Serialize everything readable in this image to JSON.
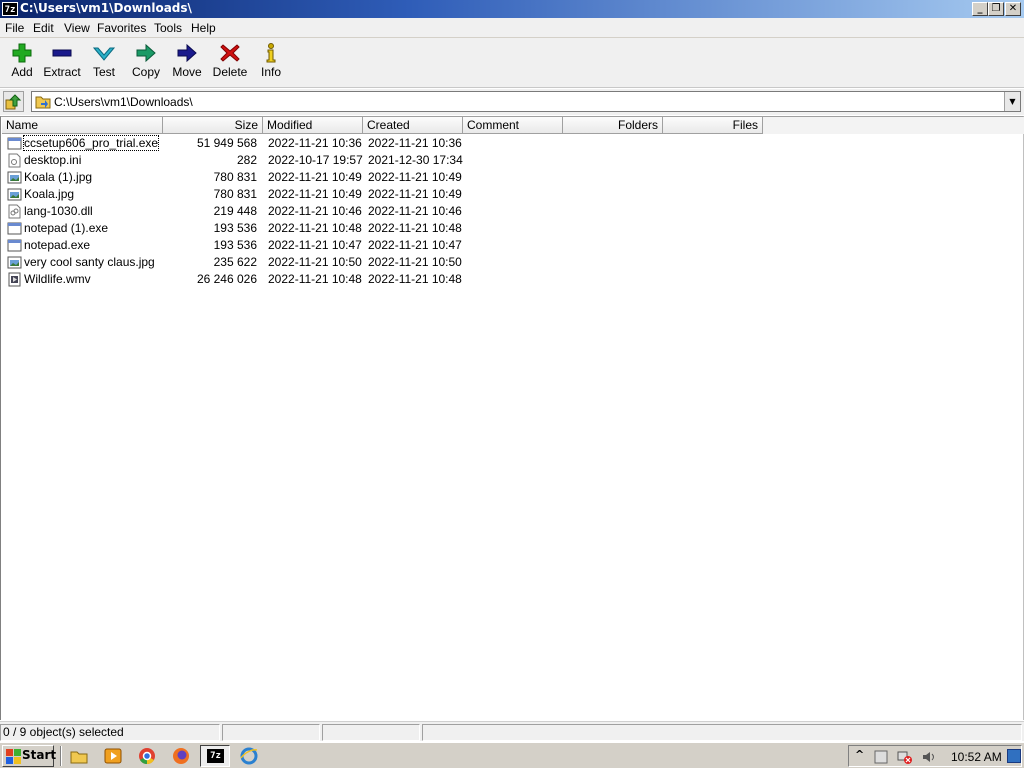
{
  "window": {
    "title": "C:\\Users\\vm1\\Downloads\\",
    "app_icon_text": "7z",
    "controls": {
      "minimize": "_",
      "maximize": "❐",
      "close": "✕"
    }
  },
  "menu": [
    "File",
    "Edit",
    "View",
    "Favorites",
    "Tools",
    "Help"
  ],
  "toolbar": [
    {
      "label": "Add",
      "icon": "add-icon",
      "color": "#22aa22"
    },
    {
      "label": "Extract",
      "icon": "extract-icon",
      "color": "#1a1a8c"
    },
    {
      "label": "Test",
      "icon": "test-icon",
      "color": "#2ab0c8"
    },
    {
      "label": "Copy",
      "icon": "copy-icon",
      "color": "#1a9a66"
    },
    {
      "label": "Move",
      "icon": "move-icon",
      "color": "#1a1a8c"
    },
    {
      "label": "Delete",
      "icon": "delete-icon",
      "color": "#d01010"
    },
    {
      "label": "Info",
      "icon": "info-icon",
      "color": "#c8a800"
    }
  ],
  "address": {
    "path": "C:\\Users\\vm1\\Downloads\\"
  },
  "columns": [
    "Name",
    "Size",
    "Modified",
    "Created",
    "Comment",
    "Folders",
    "Files"
  ],
  "files": [
    {
      "name": "ccsetup606_pro_trial.exe",
      "size": "51 949 568",
      "modified": "2022-11-21 10:36",
      "created": "2022-11-21 10:36",
      "icon": "exe-icon"
    },
    {
      "name": "desktop.ini",
      "size": "282",
      "modified": "2022-10-17 19:57",
      "created": "2021-12-30 17:34",
      "icon": "settings-file-icon"
    },
    {
      "name": "Koala (1).jpg",
      "size": "780 831",
      "modified": "2022-11-21 10:49",
      "created": "2022-11-21 10:49",
      "icon": "image-icon"
    },
    {
      "name": "Koala.jpg",
      "size": "780 831",
      "modified": "2022-11-21 10:49",
      "created": "2022-11-21 10:49",
      "icon": "image-icon"
    },
    {
      "name": "lang-1030.dll",
      "size": "219 448",
      "modified": "2022-11-21 10:46",
      "created": "2022-11-21 10:46",
      "icon": "dll-icon"
    },
    {
      "name": "notepad (1).exe",
      "size": "193 536",
      "modified": "2022-11-21 10:48",
      "created": "2022-11-21 10:48",
      "icon": "exe-icon"
    },
    {
      "name": "notepad.exe",
      "size": "193 536",
      "modified": "2022-11-21 10:47",
      "created": "2022-11-21 10:47",
      "icon": "exe-icon"
    },
    {
      "name": "very cool santy claus.jpg",
      "size": "235 622",
      "modified": "2022-11-21 10:50",
      "created": "2022-11-21 10:50",
      "icon": "image-icon"
    },
    {
      "name": "Wildlife.wmv",
      "size": "26 246 026",
      "modified": "2022-11-21 10:48",
      "created": "2022-11-21 10:48",
      "icon": "video-icon"
    }
  ],
  "status": {
    "selection": "0 / 9 object(s) selected"
  },
  "taskbar": {
    "start_label": "Start",
    "quick_launch": [
      "explorer-icon",
      "media-player-icon",
      "chrome-icon",
      "firefox-icon"
    ],
    "active_task_icon_text": "7z",
    "ie_icon": "internet-explorer-icon",
    "clock": "10:52 AM"
  }
}
